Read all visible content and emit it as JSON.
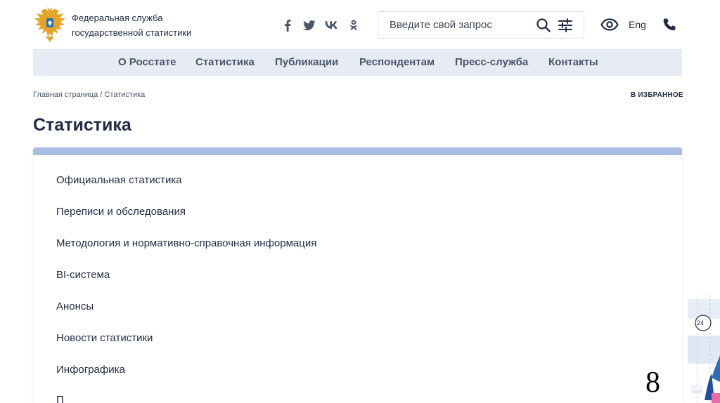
{
  "header": {
    "org_line1": "Федеральная служба",
    "org_line2": "государственной статистики",
    "search": {
      "placeholder": "Введите свой запрос",
      "value": ""
    },
    "lang": "Eng"
  },
  "nav": {
    "items": [
      {
        "label": "О Росстате"
      },
      {
        "label": "Статистика"
      },
      {
        "label": "Публикации"
      },
      {
        "label": "Респондентам"
      },
      {
        "label": "Пресс-служба"
      },
      {
        "label": "Контакты"
      }
    ]
  },
  "breadcrumb": "Главная страница / Статистика",
  "favorites": "В ИЗБРАННОЕ",
  "page_title": "Статистика",
  "menu": {
    "items": [
      {
        "label": "Официальная статистика"
      },
      {
        "label": "Переписи и обследования"
      },
      {
        "label": "Методология и нормативно-справочная информация"
      },
      {
        "label": "BI-система"
      },
      {
        "label": "Анонсы"
      },
      {
        "label": "Новости статистики"
      },
      {
        "label": "Инфографика"
      },
      {
        "label": "П"
      }
    ]
  },
  "decoration_badge": "24",
  "slide_number": "8"
}
